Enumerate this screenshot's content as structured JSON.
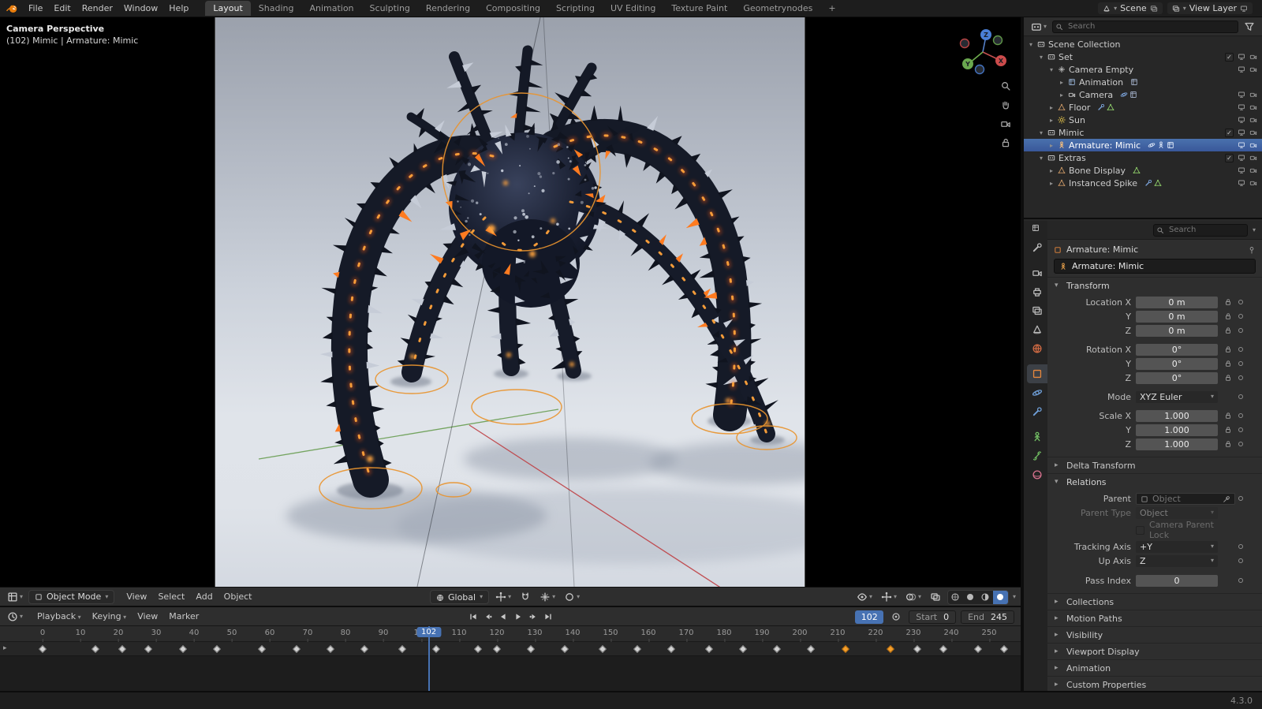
{
  "app": {
    "version": "4.3.0"
  },
  "topbar": {
    "menus": [
      "File",
      "Edit",
      "Render",
      "Window",
      "Help"
    ],
    "workspaces": [
      "Layout",
      "Shading",
      "Animation",
      "Sculpting",
      "Rendering",
      "Compositing",
      "Scripting",
      "UV Editing",
      "Texture Paint",
      "Geometrynodes"
    ],
    "active_workspace": "Layout",
    "add_tab": "+",
    "scene_label": "Scene",
    "view_layer_label": "View Layer"
  },
  "viewport": {
    "overlay_line1": "Camera Perspective",
    "overlay_line2": "(102) Mimic | Armature: Mimic",
    "axis_labels": {
      "x": "X",
      "y": "Y",
      "z": "Z"
    },
    "header": {
      "mode": "Object Mode",
      "menus": [
        "View",
        "Select",
        "Add",
        "Object"
      ],
      "orientation": "Global"
    }
  },
  "outliner": {
    "search_placeholder": "Search",
    "rows": [
      {
        "label": "Scene Collection",
        "depth": 0,
        "icon": "box",
        "arrow": "down",
        "toggles": []
      },
      {
        "label": "Set",
        "depth": 1,
        "icon": "box",
        "arrow": "down",
        "checkbox": true,
        "toggles": [
          "monitor",
          "camera"
        ]
      },
      {
        "label": "Camera Empty",
        "depth": 2,
        "icon": "empty",
        "arrow": "down",
        "toggles": [
          "monitor",
          "camera"
        ]
      },
      {
        "label": "Animation",
        "depth": 3,
        "icon": "action",
        "arrow": "right",
        "trailing": [
          "action"
        ],
        "toggles": []
      },
      {
        "label": "Camera",
        "depth": 3,
        "icon": "camera",
        "arrow": "right",
        "trailing": [
          "orbit",
          "action"
        ],
        "toggles": [
          "monitor",
          "camera"
        ]
      },
      {
        "label": "Floor",
        "depth": 2,
        "icon": "mesh",
        "arrow": "right",
        "trailing": [
          "wrench",
          "mesh"
        ],
        "toggles": [
          "monitor",
          "camera"
        ]
      },
      {
        "label": "Sun",
        "depth": 2,
        "icon": "sun",
        "arrow": "right",
        "toggles": [
          "monitor",
          "camera"
        ]
      },
      {
        "label": "Mimic",
        "depth": 1,
        "icon": "box",
        "arrow": "down",
        "checkbox": true,
        "toggles": [
          "monitor",
          "camera"
        ]
      },
      {
        "label": "Armature: Mimic",
        "depth": 2,
        "icon": "armature",
        "arrow": "right",
        "selected": true,
        "trailing": [
          "orbit",
          "armature",
          "action"
        ],
        "toggles": [
          "monitor",
          "camera"
        ]
      },
      {
        "label": "Extras",
        "depth": 1,
        "icon": "box",
        "arrow": "down",
        "checkbox": true,
        "toggles": [
          "monitor",
          "camera"
        ]
      },
      {
        "label": "Bone Display",
        "depth": 2,
        "icon": "mesh",
        "arrow": "right",
        "trailing": [
          "mesh"
        ],
        "toggles": [
          "monitor",
          "camera"
        ]
      },
      {
        "label": "Instanced Spike",
        "depth": 2,
        "icon": "mesh",
        "arrow": "right",
        "trailing": [
          "wrench",
          "mesh"
        ],
        "toggles": [
          "monitor",
          "camera"
        ]
      }
    ]
  },
  "properties": {
    "search_placeholder": "Search",
    "breadcrumb": "Armature: Mimic",
    "name_value": "Armature: Mimic",
    "tabs": [
      "tool",
      "render",
      "output",
      "view-layer",
      "scene",
      "world",
      "object",
      "physics",
      "constraints",
      "object-data",
      "bone",
      "material"
    ],
    "active_tab": "object",
    "transform": {
      "title": "Transform",
      "rows": [
        {
          "label": "Location X",
          "value": "0 m",
          "type": "number",
          "lock": true
        },
        {
          "label": "Y",
          "value": "0 m",
          "type": "number",
          "lock": true
        },
        {
          "label": "Z",
          "value": "0 m",
          "type": "number",
          "lock": true
        },
        {
          "label": "Rotation X",
          "value": "0°",
          "type": "number",
          "lock": true
        },
        {
          "label": "Y",
          "value": "0°",
          "type": "number",
          "lock": true
        },
        {
          "label": "Z",
          "value": "0°",
          "type": "number",
          "lock": true
        },
        {
          "label": "Mode",
          "value": "XYZ Euler",
          "type": "dropdown",
          "lock": false
        },
        {
          "label": "Scale X",
          "value": "1.000",
          "type": "number",
          "lock": true
        },
        {
          "label": "Y",
          "value": "1.000",
          "type": "number",
          "lock": true
        },
        {
          "label": "Z",
          "value": "1.000",
          "type": "number",
          "lock": true
        }
      ]
    },
    "delta_transform": "Delta Transform",
    "relations": {
      "title": "Relations",
      "parent_label": "Parent",
      "parent_placeholder": "Object",
      "parent_type_label": "Parent Type",
      "parent_type_value": "Object",
      "camera_parent_lock": "Camera Parent Lock",
      "tracking_axis_label": "Tracking Axis",
      "tracking_axis_value": "+Y",
      "up_axis_label": "Up Axis",
      "up_axis_value": "Z",
      "pass_index_label": "Pass Index",
      "pass_index_value": "0"
    },
    "collapsed_sections": [
      "Collections",
      "Motion Paths",
      "Visibility",
      "Viewport Display",
      "Animation",
      "Custom Properties"
    ]
  },
  "timeline": {
    "menus": [
      {
        "label": "Playback",
        "chevron": true
      },
      {
        "label": "Keying",
        "chevron": true
      },
      {
        "label": "View",
        "chevron": false
      },
      {
        "label": "Marker",
        "chevron": false
      }
    ],
    "current_frame": 102,
    "start_label": "Start",
    "start_value": "0",
    "end_label": "End",
    "end_value": "245",
    "ruler": {
      "min": 0,
      "max": 250,
      "step": 10
    },
    "keyframes": [
      0,
      14,
      21,
      28,
      37,
      46,
      58,
      67,
      76,
      85,
      95,
      104,
      115,
      120,
      129,
      138,
      148,
      157,
      166,
      176,
      185,
      194,
      203,
      212,
      224,
      231,
      238,
      247,
      254
    ],
    "selected_keyframes": [
      212,
      224
    ]
  }
}
